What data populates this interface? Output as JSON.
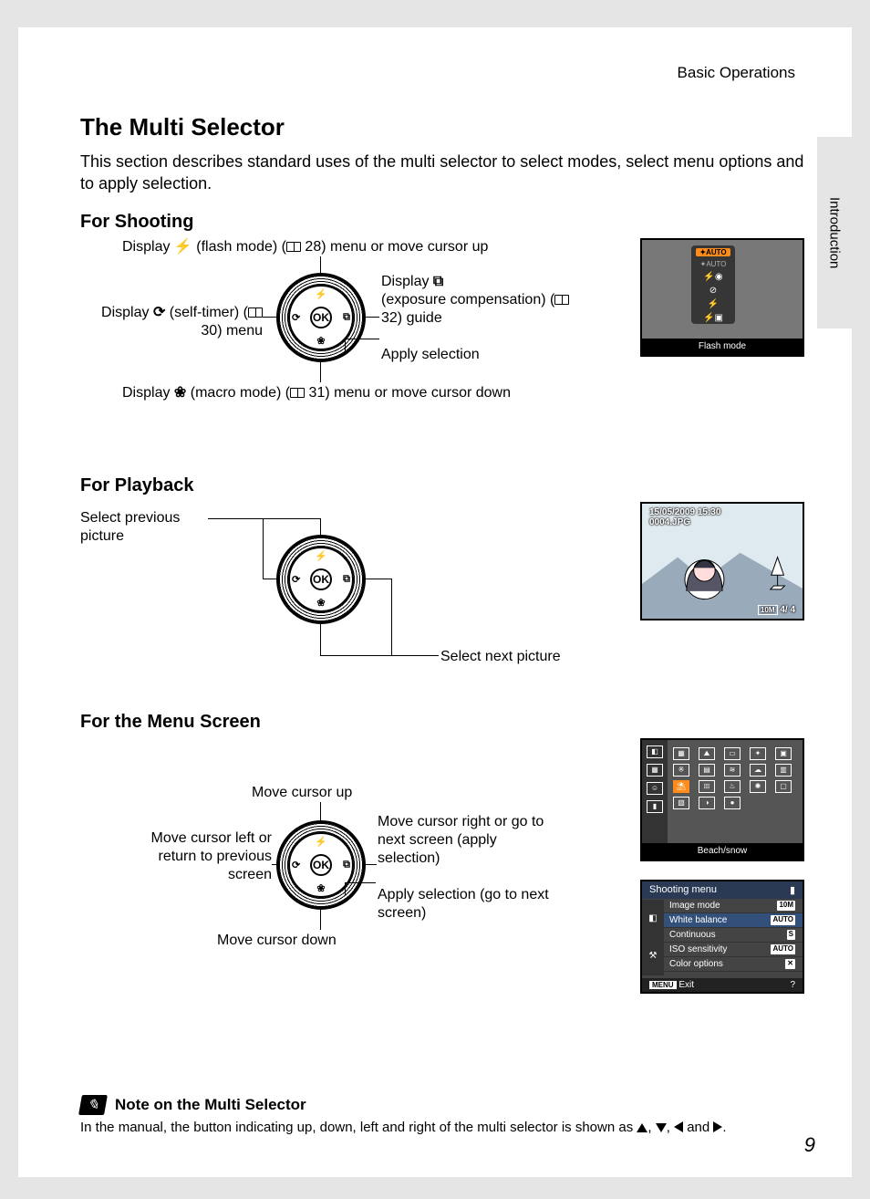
{
  "header": {
    "running": "Basic Operations",
    "tab": "Introduction"
  },
  "title": "The Multi Selector",
  "intro": "This section describes standard uses of the multi selector to select modes, select menu options and to apply selection.",
  "shooting": {
    "heading": "For Shooting",
    "up": {
      "pre": "Display ",
      "mid": " (flash mode) (",
      "page": " 28) menu or move cursor up"
    },
    "left": {
      "pre": "Display ",
      "mid": " (self-timer) (",
      "page": " 30) menu"
    },
    "right_top": "Display",
    "right_mid": "(exposure compensation) (",
    "right_page": " 32) guide",
    "ok": "Apply selection",
    "down": {
      "pre": "Display ",
      "mid": " (macro mode) (",
      "page": " 31) menu or move cursor down"
    },
    "lcd": {
      "auto_sel": "✦AUTO",
      "auto_dim": "✦AUTO",
      "caption": "Flash mode"
    }
  },
  "playback": {
    "heading": "For Playback",
    "prev": "Select previous picture",
    "next": "Select next picture",
    "lcd": {
      "date": "15/05/2009 15:30",
      "file": "0004.JPG",
      "idx": "4/",
      "total": "4"
    }
  },
  "menu": {
    "heading": "For the Menu Screen",
    "up": "Move cursor up",
    "right": "Move cursor right or go to next screen (apply selection)",
    "ok": "Apply selection (go to next screen)",
    "left": "Move cursor left or return to previous screen",
    "down": "Move cursor down",
    "scene_caption": "Beach/snow",
    "shooting_menu": {
      "title": "Shooting menu",
      "items": [
        {
          "label": "Image mode",
          "badge": "10M"
        },
        {
          "label": "White balance",
          "badge": "AUTO"
        },
        {
          "label": "Continuous",
          "badge": "S"
        },
        {
          "label": "ISO sensitivity",
          "badge": "AUTO"
        },
        {
          "label": "Color options",
          "badge": "✕"
        }
      ],
      "exit": "Exit",
      "exit_badge": "MENU"
    }
  },
  "note": {
    "title": "Note on the Multi Selector",
    "body_pre": "In the manual, the button indicating up, down, left and right of the multi selector is shown as ",
    "body_mid1": ", ",
    "body_mid2": ", ",
    "body_and": " and ",
    "body_end": "."
  },
  "page_number": "9"
}
